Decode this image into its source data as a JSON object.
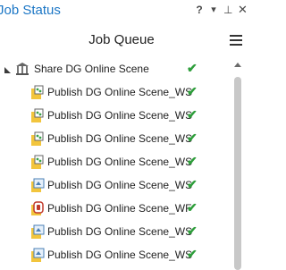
{
  "pane": {
    "title": "Job Status",
    "controls": {
      "help": "?",
      "options": "▾",
      "pin": "⊥",
      "close": "✕"
    }
  },
  "queue": {
    "title": "Job Queue"
  },
  "tree": {
    "parent": {
      "label": "Share DG Online Scene",
      "status": "success"
    },
    "children": [
      {
        "label": "Publish DG Online Scene_WS",
        "icon": "publish-service-icon",
        "status": "success"
      },
      {
        "label": "Publish DG Online Scene_WS",
        "icon": "publish-service-icon",
        "status": "success"
      },
      {
        "label": "Publish DG Online Scene_WS",
        "icon": "publish-service-icon",
        "status": "success"
      },
      {
        "label": "Publish DG Online Scene_WS",
        "icon": "publish-service-icon",
        "status": "success"
      },
      {
        "label": "Publish DG Online Scene_WS",
        "icon": "publish-layer-icon",
        "status": "success"
      },
      {
        "label": "Publish DG Online Scene_WF",
        "icon": "publish-feature-icon",
        "status": "success"
      },
      {
        "label": "Publish DG Online Scene_WS",
        "icon": "publish-layer-icon",
        "status": "success"
      },
      {
        "label": "Publish DG Online Scene_WS",
        "icon": "publish-layer-icon",
        "status": "success"
      }
    ]
  },
  "colors": {
    "title": "#1b76c5",
    "success": "#2e9e3b"
  }
}
